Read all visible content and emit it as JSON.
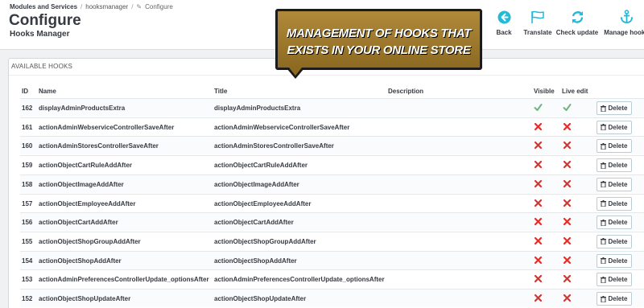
{
  "breadcrumb": {
    "items": [
      "Modules and Services",
      "hooksmanager",
      "Configure"
    ]
  },
  "page": {
    "title": "Configure",
    "subtitle": "Hooks Manager"
  },
  "toolbar": [
    {
      "label": "Back",
      "icon": "arrow-left-circle-icon"
    },
    {
      "label": "Translate",
      "icon": "flag-icon"
    },
    {
      "label": "Check update",
      "icon": "refresh-icon"
    },
    {
      "label": "Manage hooks",
      "icon": "anchor-icon"
    }
  ],
  "callout": {
    "line1": "MANAGEMENT OF HOOKS THAT",
    "line2": "EXISTS IN YOUR ONLINE STORE"
  },
  "panel": {
    "title": "AVAILABLE HOOKS"
  },
  "table": {
    "headers": {
      "id": "ID",
      "name": "Name",
      "title": "Title",
      "description": "Description",
      "visible": "Visible",
      "live_edit": "Live edit"
    },
    "delete_label": "Delete",
    "rows": [
      {
        "id": "162",
        "name": "displayAdminProductsExtra",
        "title": "displayAdminProductsExtra",
        "visible": true,
        "live_edit": true
      },
      {
        "id": "161",
        "name": "actionAdminWebserviceControllerSaveAfter",
        "title": "actionAdminWebserviceControllerSaveAfter",
        "visible": false,
        "live_edit": false
      },
      {
        "id": "160",
        "name": "actionAdminStoresControllerSaveAfter",
        "title": "actionAdminStoresControllerSaveAfter",
        "visible": false,
        "live_edit": false
      },
      {
        "id": "159",
        "name": "actionObjectCartRuleAddAfter",
        "title": "actionObjectCartRuleAddAfter",
        "visible": false,
        "live_edit": false
      },
      {
        "id": "158",
        "name": "actionObjectImageAddAfter",
        "title": "actionObjectImageAddAfter",
        "visible": false,
        "live_edit": false
      },
      {
        "id": "157",
        "name": "actionObjectEmployeeAddAfter",
        "title": "actionObjectEmployeeAddAfter",
        "visible": false,
        "live_edit": false
      },
      {
        "id": "156",
        "name": "actionObjectCartAddAfter",
        "title": "actionObjectCartAddAfter",
        "visible": false,
        "live_edit": false
      },
      {
        "id": "155",
        "name": "actionObjectShopGroupAddAfter",
        "title": "actionObjectShopGroupAddAfter",
        "visible": false,
        "live_edit": false
      },
      {
        "id": "154",
        "name": "actionObjectShopAddAfter",
        "title": "actionObjectShopAddAfter",
        "visible": false,
        "live_edit": false
      },
      {
        "id": "153",
        "name": "actionAdminPreferencesControllerUpdate_optionsAfter",
        "title": "actionAdminPreferencesControllerUpdate_optionsAfter",
        "visible": false,
        "live_edit": false
      },
      {
        "id": "152",
        "name": "actionObjectShopUpdateAfter",
        "title": "actionObjectShopUpdateAfter",
        "visible": false,
        "live_edit": false
      }
    ]
  },
  "colors": {
    "accent": "#25b9d7",
    "check": "#70b580",
    "cross": "#e0302a",
    "callout": "#a07c2e"
  }
}
